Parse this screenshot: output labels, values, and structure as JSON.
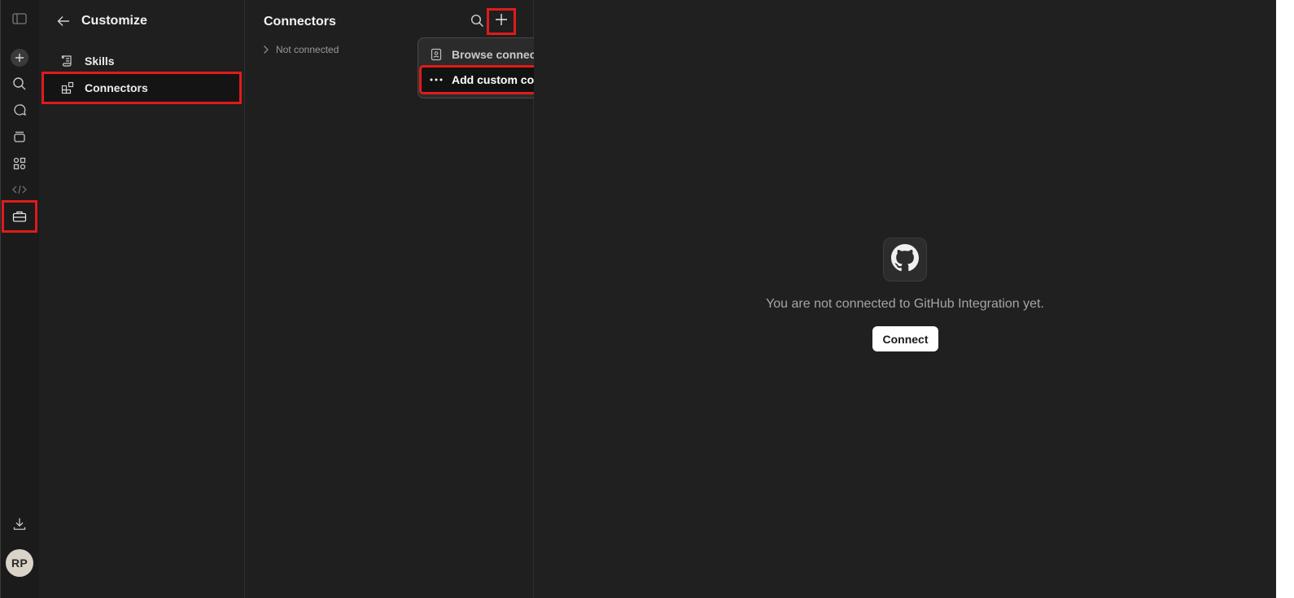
{
  "rail": {
    "items": [
      {
        "name": "sidebar-toggle-icon"
      },
      {
        "name": "new-chat-icon"
      },
      {
        "name": "search-icon"
      },
      {
        "name": "chats-icon"
      },
      {
        "name": "projects-icon"
      },
      {
        "name": "artifacts-icon"
      },
      {
        "name": "code-icon"
      },
      {
        "name": "customize-icon",
        "active": true
      }
    ],
    "download_icon": "download-icon",
    "avatar_initials": "RP"
  },
  "customize": {
    "title": "Customize",
    "nav": [
      {
        "label": "Skills",
        "icon": "skills-icon",
        "active": false
      },
      {
        "label": "Connectors",
        "icon": "connectors-icon",
        "active": true
      }
    ]
  },
  "connectors_list": {
    "title": "Connectors",
    "groups": [
      {
        "label": "Not connected",
        "expanded": false
      }
    ]
  },
  "add_menu": {
    "items": [
      {
        "label": "Browse connectors",
        "icon": "book-icon"
      },
      {
        "label": "Add custom connector",
        "icon": "ellipsis-icon",
        "highlighted": true
      }
    ]
  },
  "detail": {
    "icon": "github-icon",
    "message": "You are not connected to GitHub Integration yet.",
    "connect_label": "Connect"
  },
  "colors": {
    "highlight": "#e01b1b",
    "background": "#202020",
    "button_bg": "#ffffff"
  }
}
